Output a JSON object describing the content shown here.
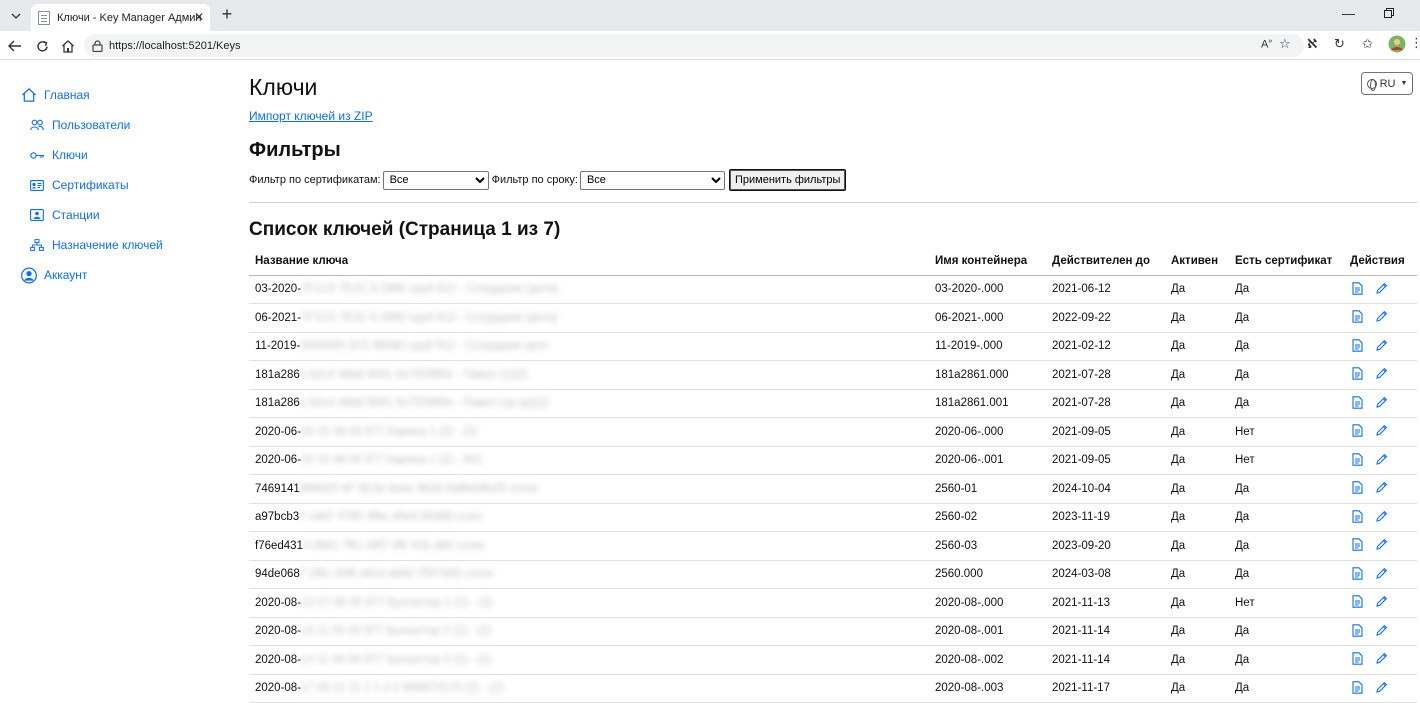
{
  "browser": {
    "tab_title": "Ключи - Key Manager Администр",
    "url": "https://localhost:5201/Keys"
  },
  "sidebar": {
    "items": [
      {
        "label": "Главная"
      },
      {
        "label": "Пользователи"
      },
      {
        "label": "Ключи"
      },
      {
        "label": "Сертификаты"
      },
      {
        "label": "Станции"
      },
      {
        "label": "Назначение ключей"
      },
      {
        "label": "Аккаунт"
      }
    ]
  },
  "header": {
    "language": "RU"
  },
  "page": {
    "title": "Ключи",
    "import_link": "Импорт ключей из ZIP",
    "filters_title": "Фильтры",
    "filter_cert_label": "Фильтр по сертификатам:",
    "filter_cert_value": "Все",
    "filter_term_label": "Фильтр по сроку:",
    "filter_term_value": "Все",
    "apply_label": "Применить фильтры",
    "list_title": "Список ключей (Страница 1 из 7)"
  },
  "table": {
    "columns": [
      "Название ключа",
      "Имя контейнера",
      "Действителен до",
      "Активен",
      "Есть сертификат",
      "Действия"
    ],
    "rows": [
      {
        "name": "03-2020-",
        "name_hidden": "7F1C5 7E2C 6 2980 сруб 812 - Сотрудник Центр",
        "container": "03-2020-.000",
        "valid": "2021-06-12",
        "active": "Да",
        "cert": "Да"
      },
      {
        "name": "06-2021-",
        "name_hidden": "7F1C5 7E2C 6 2980 сруб 812 - Сотрудник Центр",
        "container": "06-2021-.000",
        "valid": "2022-09-22",
        "active": "Да",
        "cert": "Да"
      },
      {
        "name": "11-2019-",
        "name_hidden": "0000000 2C5 98080 срцб 912 - Сотрудник цент",
        "container": "11-2019-.000",
        "valid": "2021-02-12",
        "active": "Да",
        "cert": "Да"
      },
      {
        "name": "181a286",
        "name_hidden": "1-b2c4 48dd 9001 5e7f208f0e - Павел (1)(2)",
        "container": "181a2861.000",
        "valid": "2021-07-28",
        "active": "Да",
        "cert": "Да"
      },
      {
        "name": "181a286",
        "name_hidden": "1-b2c4 48dd 9001 5e7f208f0e - Павел (ср.кр)(2)",
        "container": "181a2861.001",
        "valid": "2021-07-28",
        "active": "Да",
        "cert": "Да"
      },
      {
        "name": "2020-06-",
        "name_hidden": "20 15 48 00 977 Карина 1 (2) - (2)",
        "container": "2020-06-.000",
        "valid": "2021-09-05",
        "active": "Да",
        "cert": "Нет"
      },
      {
        "name": "2020-06-",
        "name_hidden": "20 15 48 00 977 Карина 1 (2) - 001",
        "container": "2020-06-.001",
        "valid": "2021-09-05",
        "active": "Да",
        "cert": "Нет"
      },
      {
        "name": "7469141",
        "name_hidden": "988020 4F 5E3d 4a4e 9b0d 5d9b0dfe25 сотек",
        "container": "2560-01",
        "valid": "2024-10-04",
        "active": "Да",
        "cert": "Да"
      },
      {
        "name": "a97bcb3",
        "name_hidden": "7-c8d7 4780 4f6e d0e8 85d86 crzec",
        "container": "2560-02",
        "valid": "2023-11-19",
        "active": "Да",
        "cert": "Да"
      },
      {
        "name": "f76ed431",
        "name_hidden": "4 d9d1 7f5c 48f7 9f6 41b a80 сотек",
        "container": "2560-03",
        "valid": "2023-09-20",
        "active": "Да",
        "cert": "Да"
      },
      {
        "name": "94de068",
        "name_hidden": "7 2f6c 45f8 a8cd a84d 7f5f7905 сотек",
        "container": "2560.000",
        "valid": "2024-03-08",
        "active": "Да",
        "cert": "Да"
      },
      {
        "name": "2020-08-",
        "name_hidden": "13 07 08 00 977 Бухгалтер 1 (2) - (2)",
        "container": "2020-08-.000",
        "valid": "2021-11-13",
        "active": "Да",
        "cert": "Нет"
      },
      {
        "name": "2020-08-",
        "name_hidden": "14 11 00 00 977 Бухгалтер 2 (2) - (2)",
        "container": "2020-08-.001",
        "valid": "2021-11-14",
        "active": "Да",
        "cert": "Да"
      },
      {
        "name": "2020-08-",
        "name_hidden": "14 11 00 00 977 Бухгалтер 3 (2) - (2)",
        "container": "2020-08-.002",
        "valid": "2021-11-14",
        "active": "Да",
        "cert": "Да"
      },
      {
        "name": "2020-08-",
        "name_hidden": "17 09 21 11 1 1 2 2 Ф98070170 (2) - (2)",
        "container": "2020-08-.003",
        "valid": "2021-11-17",
        "active": "Да",
        "cert": "Да"
      }
    ]
  }
}
